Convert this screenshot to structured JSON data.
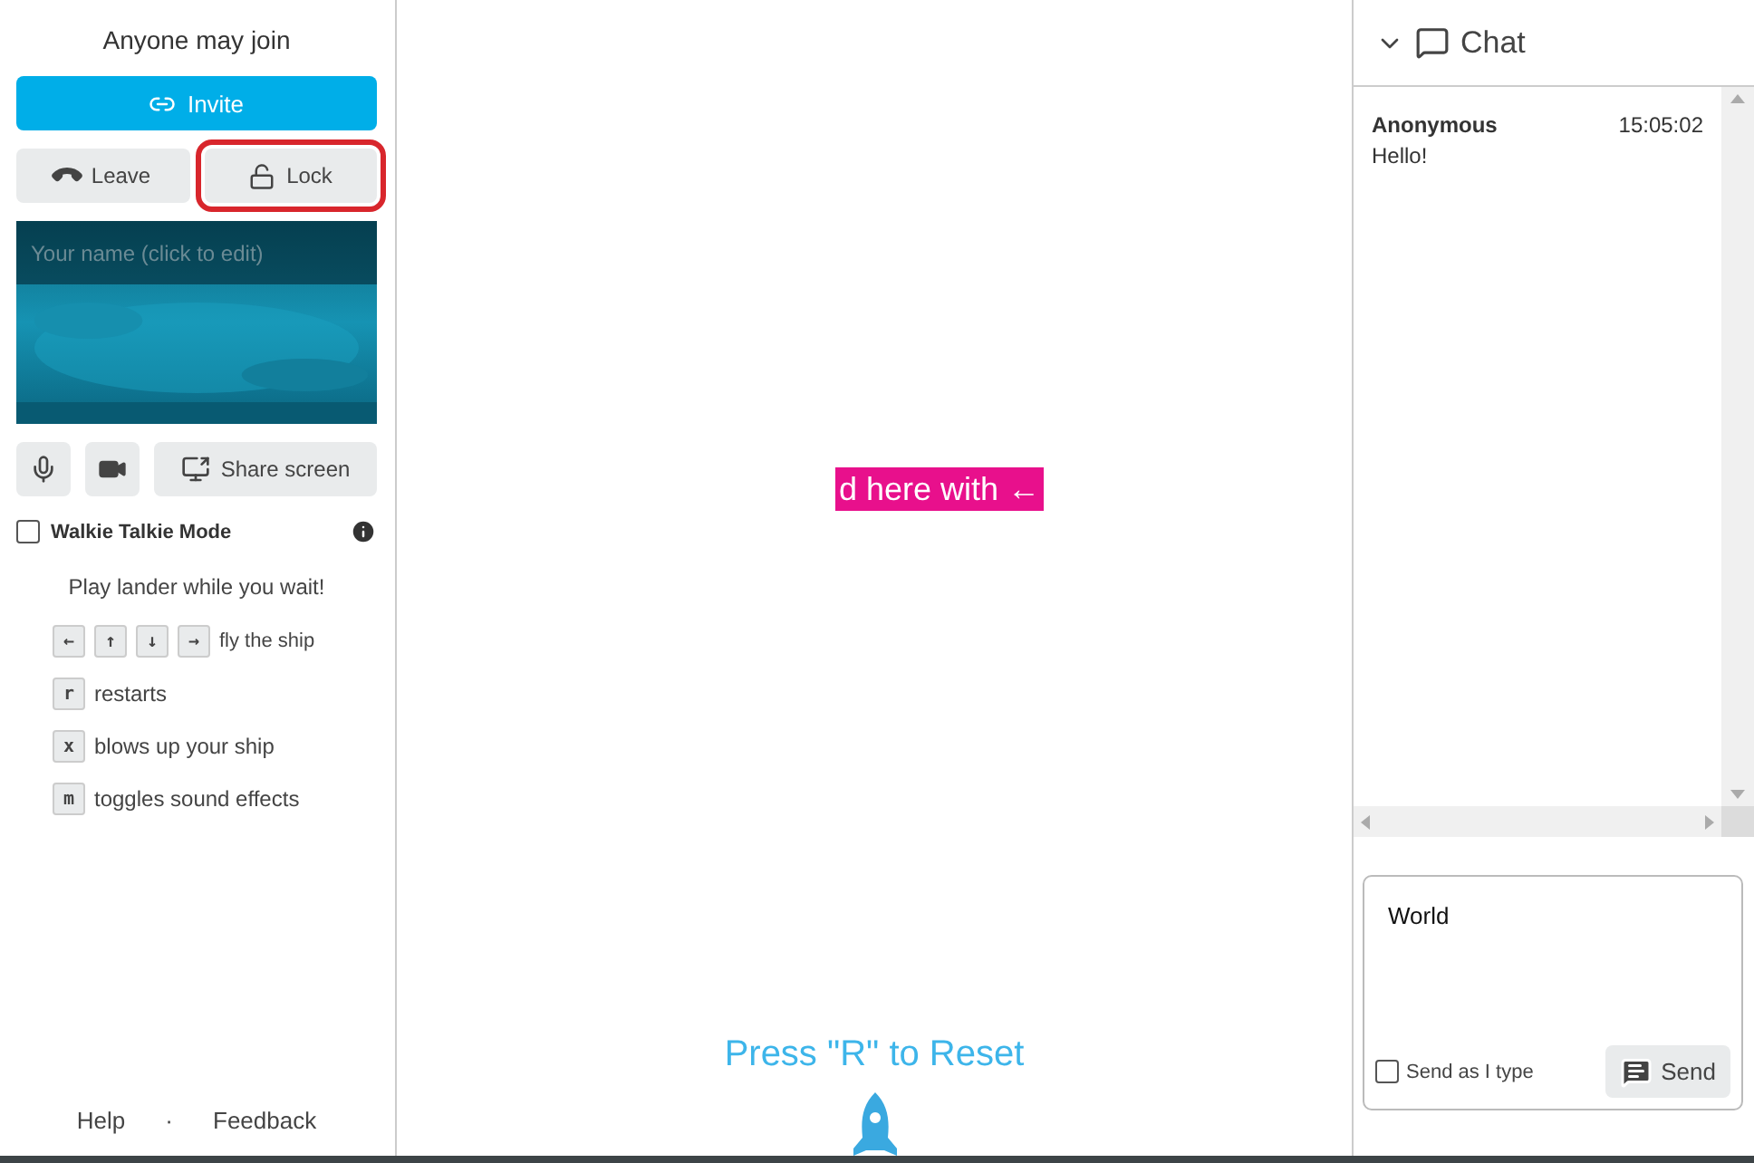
{
  "sidebar": {
    "room_status": "Anyone may join",
    "invite_button": {
      "label": "Invite"
    },
    "leave_button": {
      "label": "Leave"
    },
    "lock_button": {
      "label": "Lock",
      "highlighted": true
    },
    "video": {
      "kind": "picture",
      "name_placeholder": "Your name (click to edit)"
    },
    "media_buttons": [
      {
        "kind": "mic"
      },
      {
        "kind": "camera"
      },
      {
        "kind": "share",
        "label": "Share screen"
      }
    ],
    "walkie_talkie": {
      "label": "Walkie Talkie Mode",
      "checked": false
    },
    "game_title": "Play lander while you wait!",
    "controls": [
      {
        "keys": [
          "←",
          "↑",
          "↓",
          "→"
        ],
        "description": "fly the ship"
      },
      {
        "keys": [
          "r"
        ],
        "description": "restarts"
      },
      {
        "keys": [
          "x"
        ],
        "description": "blows up your ship"
      },
      {
        "keys": [
          "m"
        ],
        "description": "toggles sound effects"
      }
    ],
    "footer_links": [
      "Help",
      "Feedback"
    ],
    "footer_separator": "·"
  },
  "game": {
    "banner": "d here with ←",
    "reset_hint": "Press \"R\" to Reset"
  },
  "chat": {
    "title": "Chat",
    "expanded": true,
    "messages": [
      {
        "author": "Anonymous",
        "time": "15:05:02",
        "text": "Hello!"
      }
    ],
    "compose": {
      "value": "World",
      "send_as_type": {
        "label": "Send as I type",
        "checked": false
      },
      "send_button": "Send"
    }
  }
}
